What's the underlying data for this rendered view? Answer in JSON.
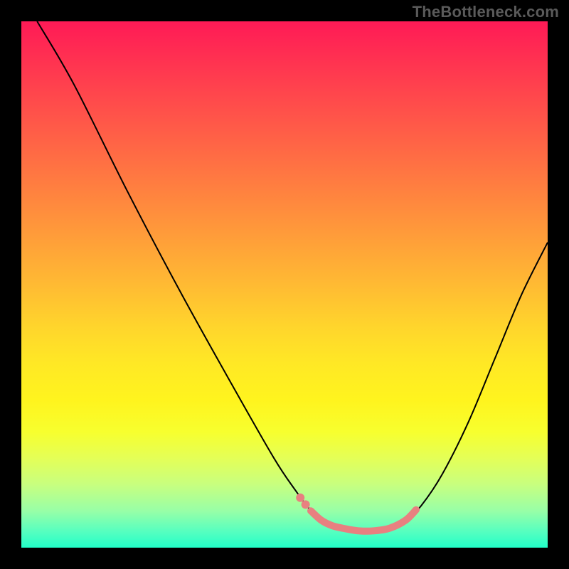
{
  "watermark": "TheBottleneck.com",
  "chart_data": {
    "type": "line",
    "title": "",
    "xlabel": "",
    "ylabel": "",
    "xlim": [
      0,
      100
    ],
    "ylim": [
      0,
      100
    ],
    "background_gradient": {
      "top": "#ff1a56",
      "bottom": "#22ffc8"
    },
    "main_curve": {
      "stroke": "#000000",
      "stroke_width": 2,
      "points": [
        [
          3,
          100
        ],
        [
          10,
          88
        ],
        [
          20,
          68
        ],
        [
          30,
          49
        ],
        [
          40,
          31
        ],
        [
          48,
          17
        ],
        [
          52,
          11
        ],
        [
          55,
          7
        ],
        [
          57,
          5
        ],
        [
          59,
          4
        ],
        [
          61,
          3.5
        ],
        [
          64,
          3
        ],
        [
          67,
          3
        ],
        [
          70,
          3.5
        ],
        [
          73,
          5
        ],
        [
          76,
          8
        ],
        [
          80,
          14
        ],
        [
          85,
          24
        ],
        [
          90,
          36
        ],
        [
          95,
          48
        ],
        [
          100,
          58
        ]
      ]
    },
    "pink_segment": {
      "stroke": "#e88080",
      "stroke_width": 10,
      "points": [
        [
          55,
          7
        ],
        [
          57,
          5.2
        ],
        [
          59,
          4.2
        ],
        [
          61,
          3.7
        ],
        [
          64,
          3.2
        ],
        [
          67,
          3.2
        ],
        [
          70,
          3.7
        ],
        [
          73,
          5.2
        ],
        [
          75,
          7.2
        ]
      ]
    },
    "pink_dots": {
      "fill": "#e88080",
      "radius": 6,
      "points": [
        [
          53,
          9.5
        ],
        [
          54,
          8.2
        ]
      ]
    }
  }
}
